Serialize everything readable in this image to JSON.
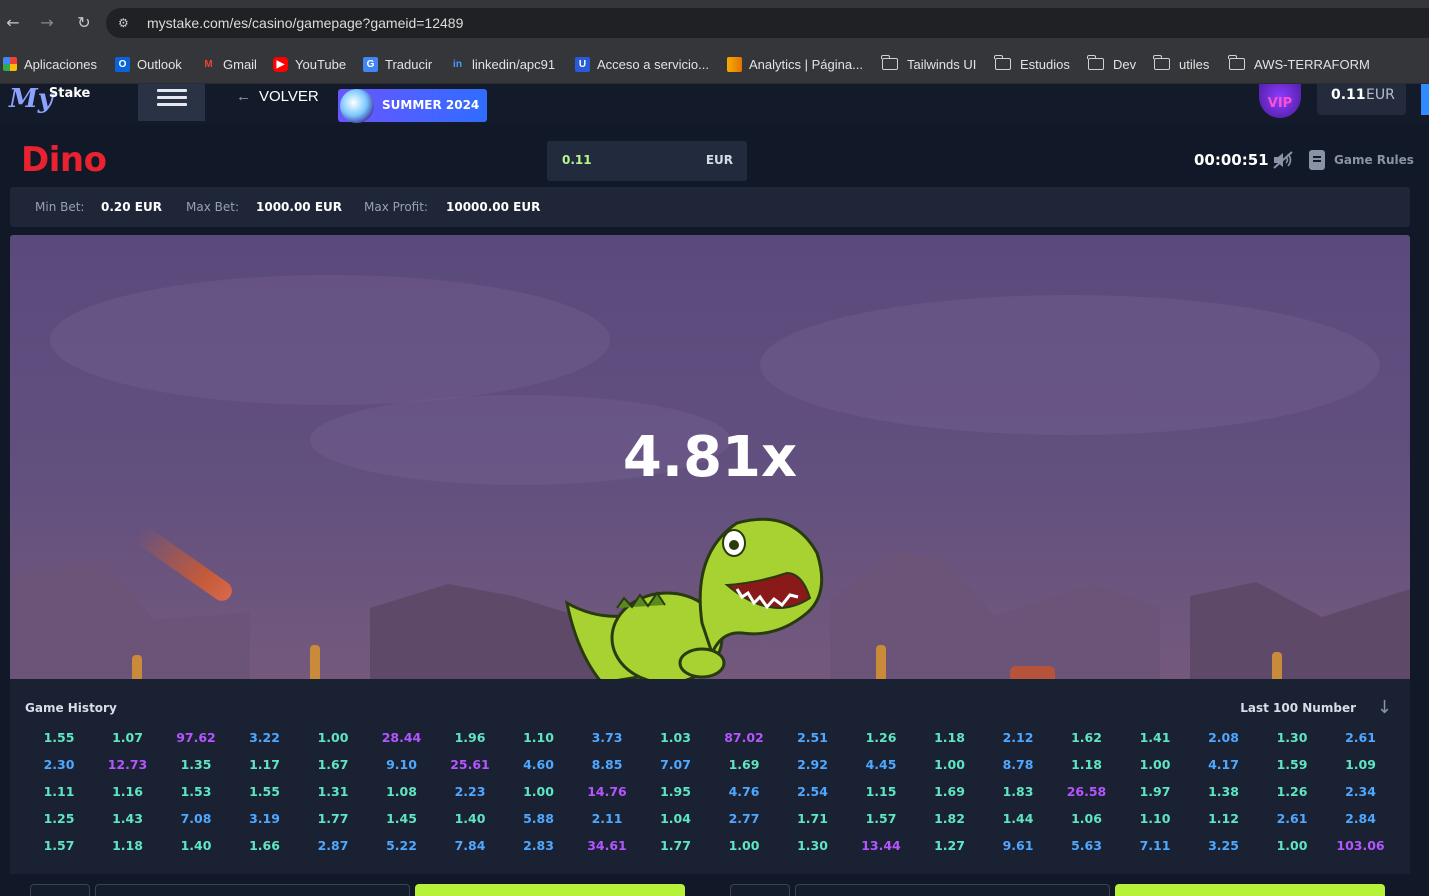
{
  "browser": {
    "url": "mystake.com/es/casino/gamepage?gameid=12489",
    "bookmarks": [
      "Aplicaciones",
      "Outlook",
      "Gmail",
      "YouTube",
      "Traducir",
      "linkedin/apc91",
      "Acceso a servicio...",
      "Analytics | Página...",
      "Tailwinds UI",
      "Estudios",
      "Dev",
      "utiles",
      "AWS-TERRAFORM"
    ]
  },
  "header": {
    "logo_my": "My",
    "logo_stake": "Stake",
    "back_label": "VOLVER",
    "promo_label": "SUMMER 2024",
    "vip_label": "VIP",
    "balance_value": "0.11",
    "balance_currency": "EUR"
  },
  "game": {
    "title": "Dino",
    "bet_value": "0.11",
    "bet_currency": "EUR",
    "timer": "00:00:51",
    "rules_label": "Game Rules",
    "min_bet_label": "Min Bet:",
    "min_bet_value": "0.20 EUR",
    "max_bet_label": "Max Bet:",
    "max_bet_value": "1000.00 EUR",
    "max_profit_label": "Max Profit:",
    "max_profit_value": "10000.00 EUR",
    "multiplier": "4.81x"
  },
  "history": {
    "title": "Game History",
    "last_label": "Last 100 Number",
    "rows": [
      [
        "1.55",
        "1.07",
        "97.62",
        "3.22",
        "1.00",
        "28.44",
        "1.96",
        "1.10",
        "3.73",
        "1.03",
        "87.02",
        "2.51",
        "1.26",
        "1.18",
        "2.12",
        "1.62",
        "1.41",
        "2.08",
        "1.30",
        "2.61"
      ],
      [
        "2.30",
        "12.73",
        "1.35",
        "1.17",
        "1.67",
        "9.10",
        "25.61",
        "4.60",
        "8.85",
        "7.07",
        "1.69",
        "2.92",
        "4.45",
        "1.00",
        "8.78",
        "1.18",
        "1.00",
        "4.17",
        "1.59",
        "1.09"
      ],
      [
        "1.11",
        "1.16",
        "1.53",
        "1.55",
        "1.31",
        "1.08",
        "2.23",
        "1.00",
        "14.76",
        "1.95",
        "4.76",
        "2.54",
        "1.15",
        "1.69",
        "1.83",
        "26.58",
        "1.97",
        "1.38",
        "1.26",
        "2.34"
      ],
      [
        "1.25",
        "1.43",
        "7.08",
        "3.19",
        "1.77",
        "1.45",
        "1.40",
        "5.88",
        "2.11",
        "1.04",
        "2.77",
        "1.71",
        "1.57",
        "1.82",
        "1.44",
        "1.06",
        "1.10",
        "1.12",
        "2.61",
        "2.84"
      ],
      [
        "1.57",
        "1.18",
        "1.40",
        "1.66",
        "2.87",
        "5.22",
        "7.84",
        "2.83",
        "34.61",
        "1.77",
        "1.00",
        "1.30",
        "13.44",
        "1.27",
        "9.61",
        "5.63",
        "7.11",
        "3.25",
        "1.00",
        "103.06"
      ]
    ]
  },
  "colors": {
    "low": "#5ee6c2",
    "mid": "#4fa8ff",
    "high": "#b455ff",
    "accent_red": "#e8232f",
    "accent_green": "#b6f23a"
  }
}
